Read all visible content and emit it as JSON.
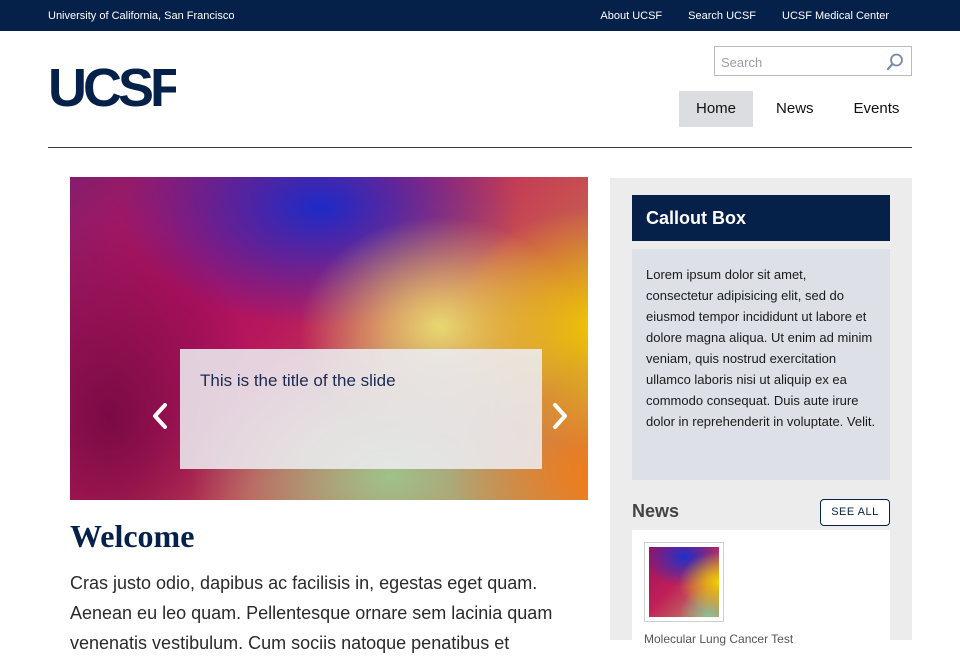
{
  "topbar": {
    "institution": "University of California, San Francisco",
    "links": [
      "About UCSF",
      "Search UCSF",
      "UCSF Medical Center"
    ]
  },
  "logo": {
    "text": "UCSF"
  },
  "search": {
    "placeholder": "Search"
  },
  "nav": {
    "items": [
      "Home",
      "News",
      "Events"
    ],
    "active": "Home"
  },
  "slider": {
    "slide_title": "This is the title of the slide"
  },
  "main": {
    "heading": "Welcome",
    "body": "Cras justo odio, dapibus ac facilisis in, egestas eget quam. Aenean eu leo quam. Pellentesque ornare sem lacinia quam venenatis vestibulum. Cum sociis natoque penatibus et"
  },
  "sidebar": {
    "callout_title": "Callout Box",
    "callout_body": "Lorem ipsum dolor sit amet, consectetur adipisicing elit, sed do eiusmod tempor incididunt ut labore et dolore magna aliqua. Ut enim ad minim veniam, quis nostrud exercitation ullamco laboris nisi ut aliquip ex ea commodo consequat. Duis aute irure dolor in reprehenderit in voluptate. Velit.",
    "news_title": "News",
    "see_all": "SEE ALL",
    "news_items": [
      {
        "title": "Molecular Lung Cancer Test"
      }
    ]
  },
  "colors": {
    "navy": "#052049",
    "callout_bg": "#dde0e6",
    "sidebar_bg": "#ececec"
  },
  "icons": {
    "search": "magnifier-icon",
    "prev": "chevron-left-icon",
    "next": "chevron-right-icon"
  }
}
